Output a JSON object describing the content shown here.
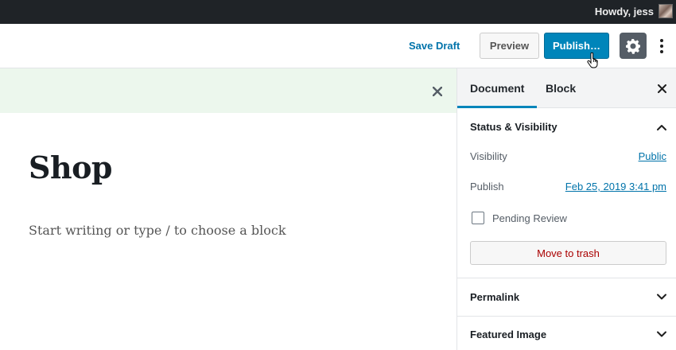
{
  "adminbar": {
    "greeting": "Howdy, jess"
  },
  "header": {
    "save_draft": "Save Draft",
    "preview": "Preview",
    "publish": "Publish…"
  },
  "editor": {
    "title": "Shop",
    "placeholder": "Start writing or type / to choose a block"
  },
  "sidebar": {
    "tabs": [
      {
        "label": "Document",
        "active": true
      },
      {
        "label": "Block",
        "active": false
      }
    ],
    "status_panel": {
      "title": "Status & Visibility",
      "visibility_label": "Visibility",
      "visibility_value": "Public",
      "publish_label": "Publish",
      "publish_value": "Feb 25, 2019 3:41 pm",
      "pending_review_label": "Pending Review",
      "pending_review_checked": false,
      "trash_button": "Move to trash"
    },
    "permalink_panel": {
      "title": "Permalink"
    },
    "featured_image_panel": {
      "title": "Featured Image"
    }
  },
  "colors": {
    "accent": "#0085ba",
    "link": "#0073aa",
    "notice_bg": "#ecf7ed",
    "danger": "#aa0000",
    "adminbar_bg": "#1f2327"
  }
}
